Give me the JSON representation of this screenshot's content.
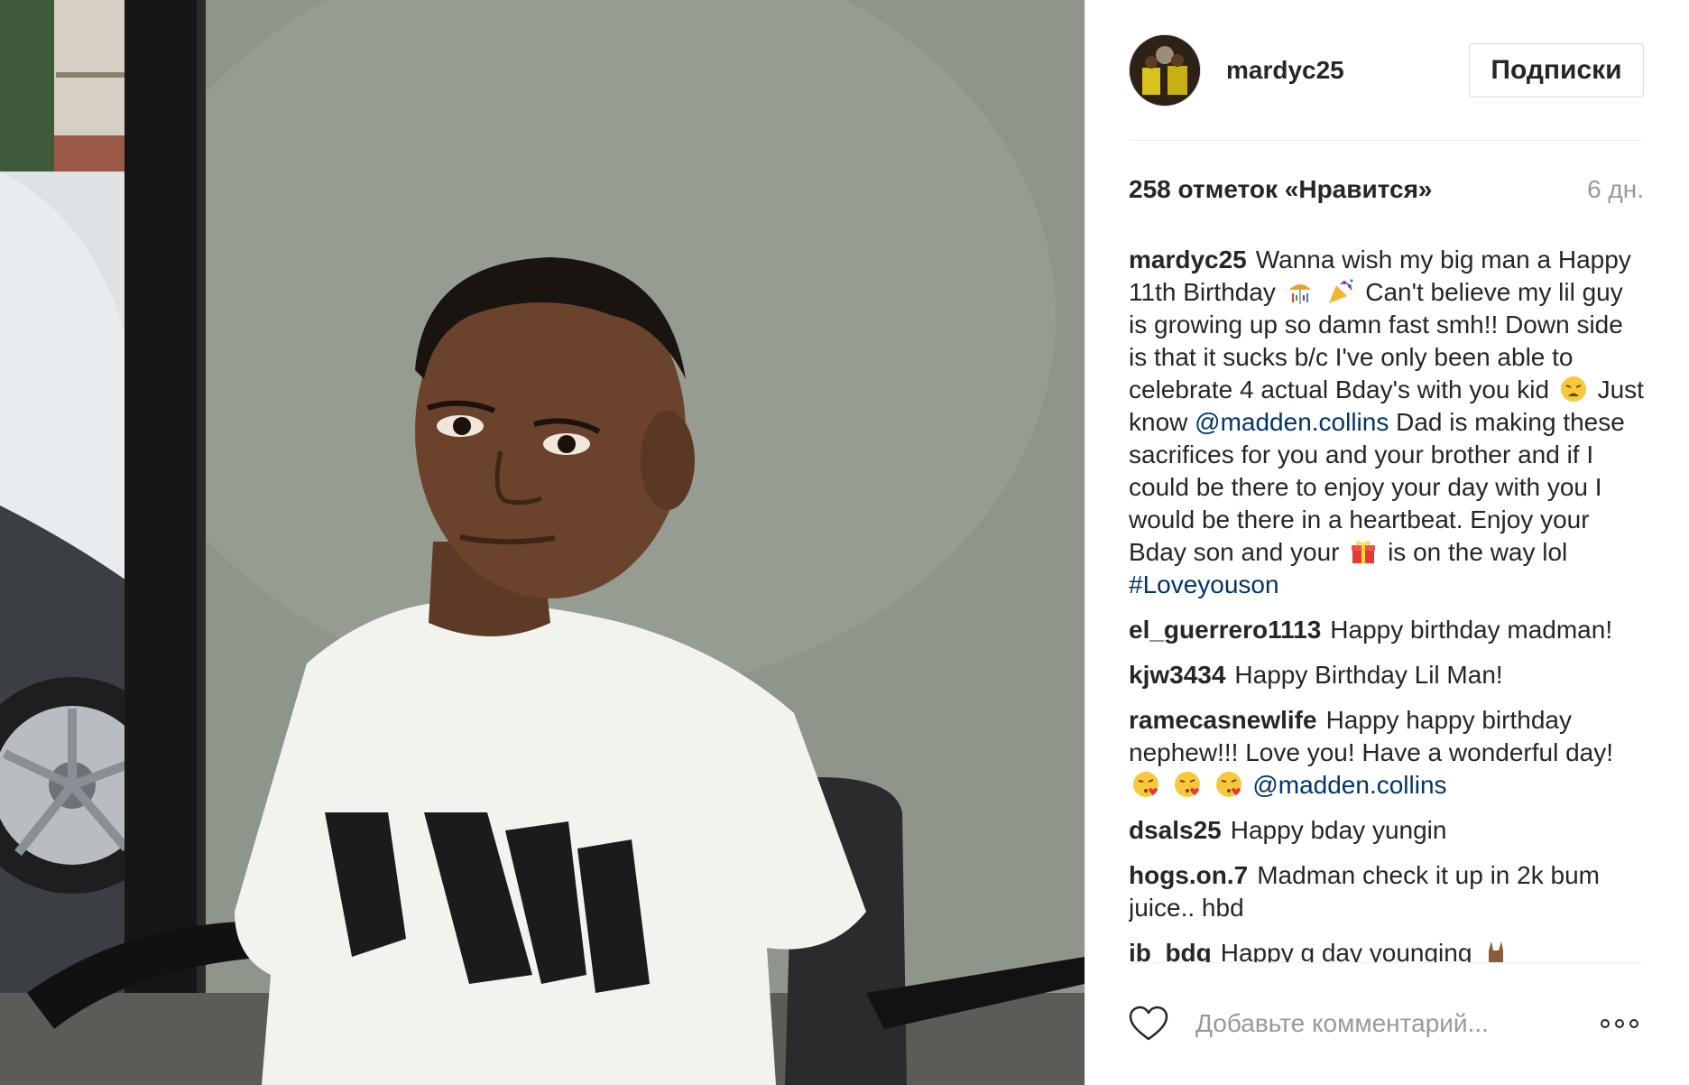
{
  "post": {
    "username": "mardyc25",
    "follow_label": "Подписки",
    "likes": "258 отметок «Нравится»",
    "time": "6 дн."
  },
  "caption": {
    "author": "mardyc25",
    "part1": "Wanna wish my big man a Happy 11th Birthday",
    "part2": "Can't believe my lil guy is growing up so damn fast smh!! Down side is that it sucks b/c I've only been able to celebrate 4 actual Bday's with you kid",
    "part3": "Just know",
    "mention": "@madden.collins",
    "part4": "Dad is making these sacrifices for you and your brother and if I could be there to enjoy your day with you I would be there in a heartbeat. Enjoy your Bday son and your",
    "part5": "is on the way lol",
    "hashtag": "#Loveyouson"
  },
  "comments": [
    {
      "author": "el_guerrero1113",
      "text": "Happy birthday madman!"
    },
    {
      "author": "kjw3434",
      "text": "Happy Birthday Lil Man!"
    },
    {
      "author": "ramecasnewlife",
      "text": "Happy happy birthday nephew!!! Love you! Have a wonderful day!",
      "mention": "@madden.collins"
    },
    {
      "author": "dsals25",
      "text": "Happy bday yungin"
    },
    {
      "author": "hogs.on.7",
      "text": "Madman check it up in 2k bum juice.. hbd"
    },
    {
      "author": "ib_bdg",
      "text": "Happy g day younging"
    }
  ],
  "footer": {
    "placeholder": "Добавьте комментарий..."
  },
  "icons": {
    "heart": "heart-icon",
    "more": "more-options-icon"
  },
  "colors": {
    "link": "#003569",
    "muted": "#999999",
    "text": "#262626"
  }
}
